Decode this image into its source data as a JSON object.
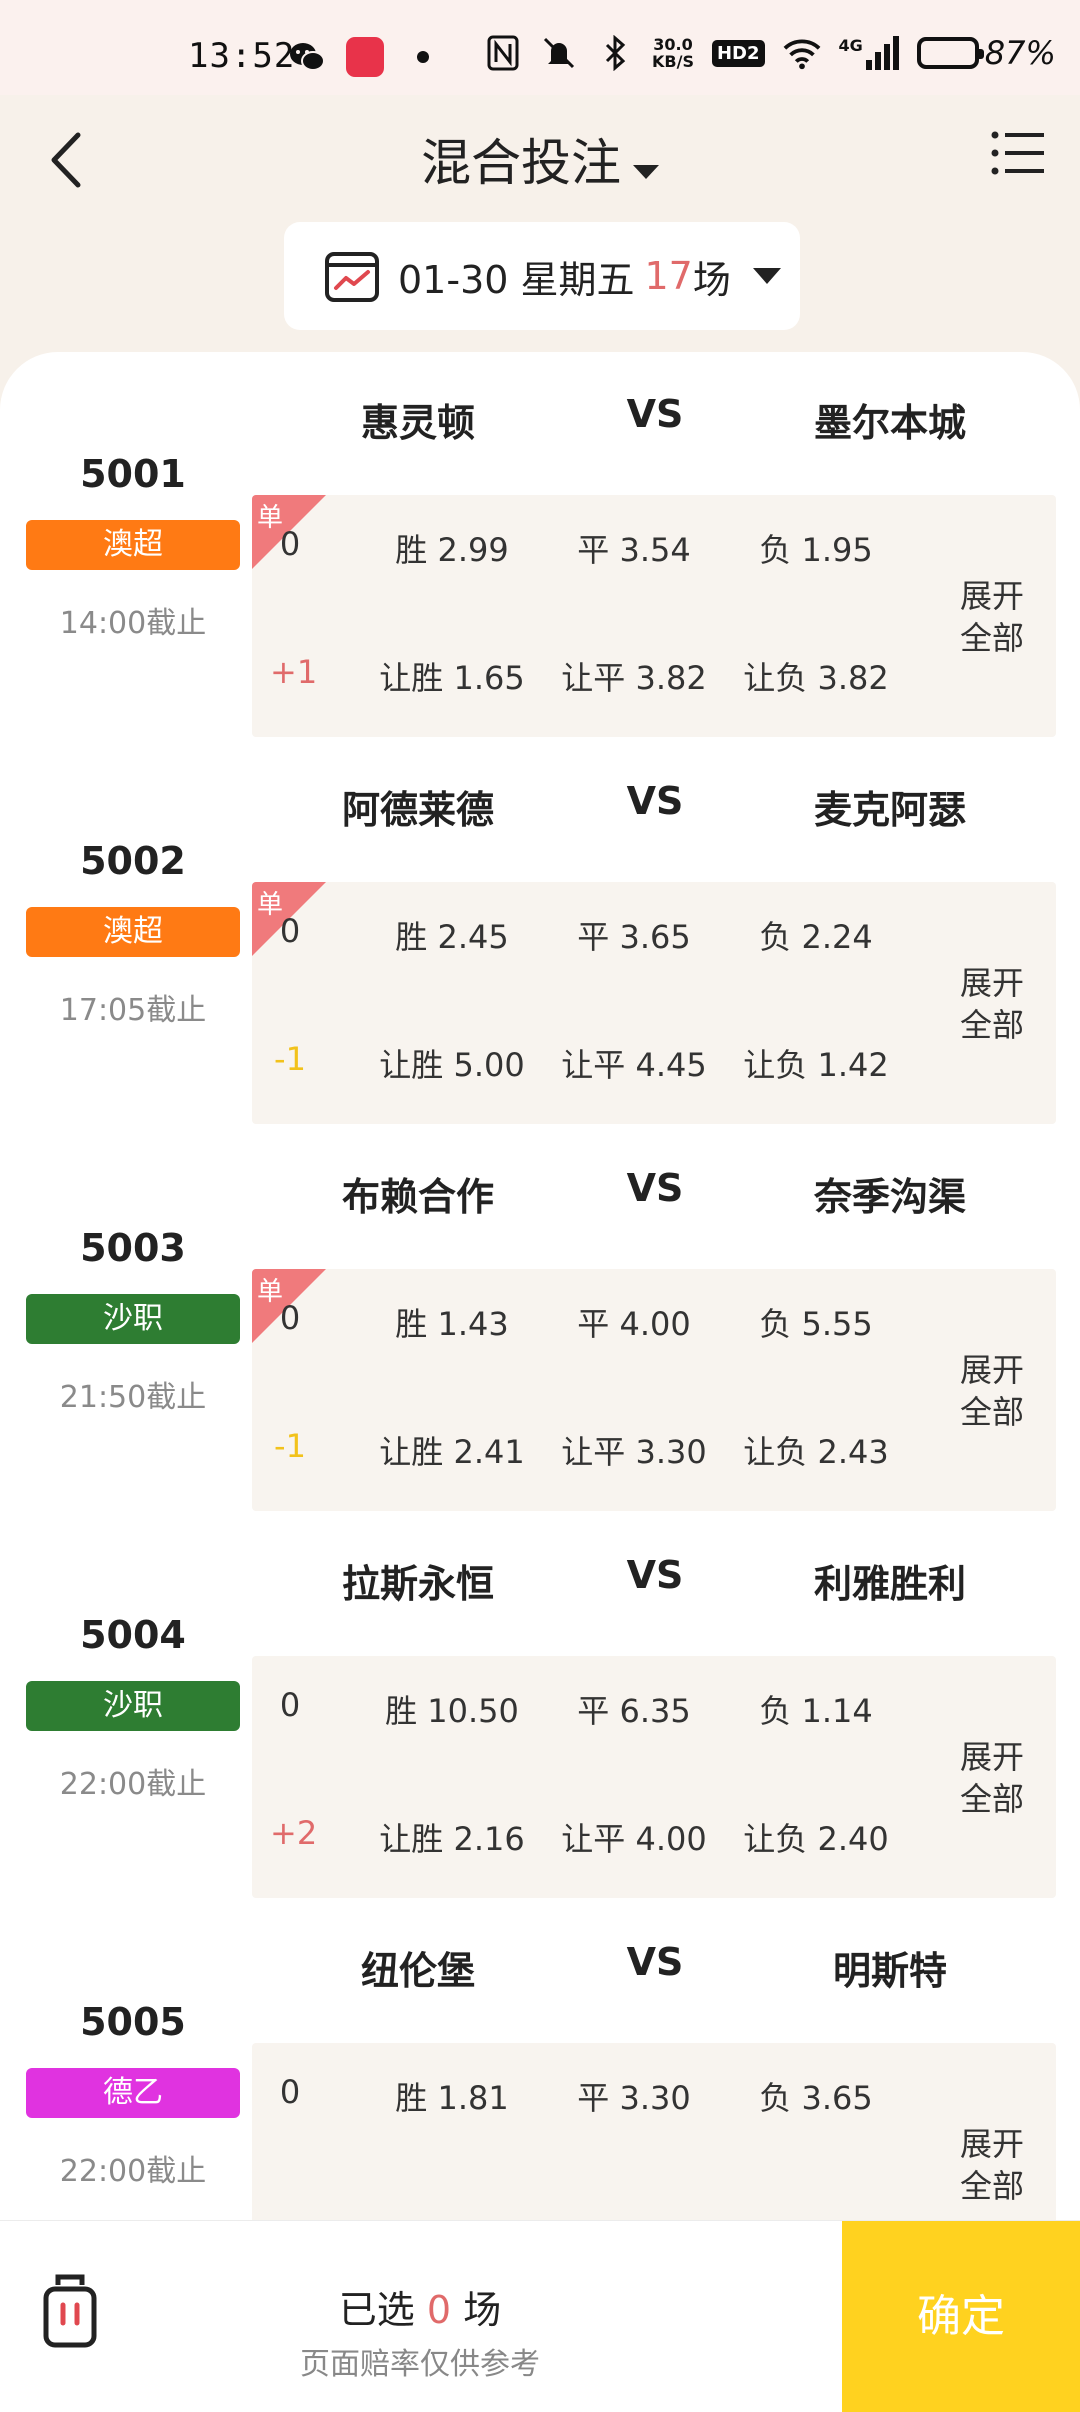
{
  "status_bar": {
    "time": "13:52",
    "net_speed_value": "30.0",
    "net_speed_unit": "KB/S",
    "hd_label": "HD2",
    "signal_label": "4G",
    "battery": "87%",
    "battery_level": 0.87
  },
  "header": {
    "title": "混合投注",
    "date": "01-30 星期五",
    "match_count": "17",
    "count_unit": "场"
  },
  "matches": [
    {
      "no": "5001",
      "league": "澳超",
      "league_color": "#ff7a14",
      "deadline": "14:00截止",
      "home": "惠灵顿",
      "vs": "VS",
      "away": "墨尔本城",
      "single": true,
      "single_label": "单",
      "r1_handicap": "0",
      "r1_handicap_color": "#333333",
      "r1": [
        "胜 2.99",
        "平 3.54",
        "负 1.95"
      ],
      "r2_handicap": "+1",
      "r2_handicap_color": "#e06a6a",
      "r2": [
        "让胜 1.65",
        "让平 3.82",
        "让负 3.82"
      ],
      "expand": [
        "展开",
        "全部"
      ]
    },
    {
      "no": "5002",
      "league": "澳超",
      "league_color": "#ff7a14",
      "deadline": "17:05截止",
      "home": "阿德莱德",
      "vs": "VS",
      "away": "麦克阿瑟",
      "single": true,
      "single_label": "单",
      "r1_handicap": "0",
      "r1_handicap_color": "#333333",
      "r1": [
        "胜 2.45",
        "平 3.65",
        "负 2.24"
      ],
      "r2_handicap": "-1",
      "r2_handicap_color": "#f2c21b",
      "r2": [
        "让胜 5.00",
        "让平 4.45",
        "让负 1.42"
      ],
      "expand": [
        "展开",
        "全部"
      ]
    },
    {
      "no": "5003",
      "league": "沙职",
      "league_color": "#2e7d32",
      "deadline": "21:50截止",
      "home": "布赖合作",
      "vs": "VS",
      "away": "奈季沟渠",
      "single": true,
      "single_label": "单",
      "r1_handicap": "0",
      "r1_handicap_color": "#333333",
      "r1": [
        "胜 1.43",
        "平 4.00",
        "负 5.55"
      ],
      "r2_handicap": "-1",
      "r2_handicap_color": "#f2c21b",
      "r2": [
        "让胜 2.41",
        "让平 3.30",
        "让负 2.43"
      ],
      "expand": [
        "展开",
        "全部"
      ]
    },
    {
      "no": "5004",
      "league": "沙职",
      "league_color": "#2e7d32",
      "deadline": "22:00截止",
      "home": "拉斯永恒",
      "vs": "VS",
      "away": "利雅胜利",
      "single": false,
      "single_label": "",
      "r1_handicap": "0",
      "r1_handicap_color": "#333333",
      "r1": [
        "胜 10.50",
        "平 6.35",
        "负 1.14"
      ],
      "r2_handicap": "+2",
      "r2_handicap_color": "#e06a6a",
      "r2": [
        "让胜 2.16",
        "让平 4.00",
        "让负 2.40"
      ],
      "expand": [
        "展开",
        "全部"
      ]
    },
    {
      "no": "5005",
      "league": "德乙",
      "league_color": "#e033e0",
      "deadline": "22:00截止",
      "home": "纽伦堡",
      "vs": "VS",
      "away": "明斯特",
      "single": false,
      "single_label": "",
      "r1_handicap": "0",
      "r1_handicap_color": "#333333",
      "r1": [
        "胜 1.81",
        "平 3.30",
        "负 3.65"
      ],
      "r2_handicap": "",
      "r2_handicap_color": "#333333",
      "r2": [
        "",
        "",
        ""
      ],
      "expand": [
        "展开",
        "全部"
      ]
    }
  ],
  "footer": {
    "selected_prefix": "已选",
    "selected_count": "0",
    "selected_suffix": "场",
    "hint": "页面赔率仅供参考",
    "confirm": "确定"
  }
}
